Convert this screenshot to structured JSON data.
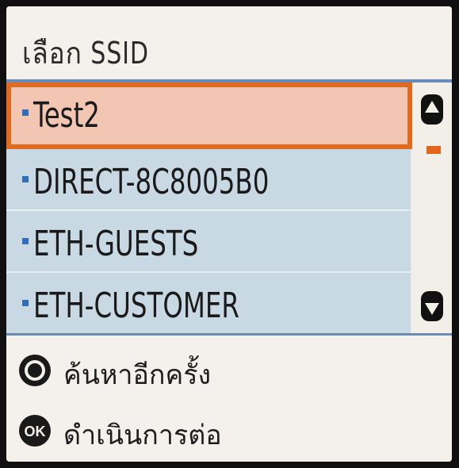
{
  "screen_title": "เลือก SSID",
  "networks": [
    {
      "label": "Test2",
      "selected": true
    },
    {
      "label": "DIRECT-8C8005B0",
      "selected": false
    },
    {
      "label": "ETH-GUESTS",
      "selected": false
    },
    {
      "label": "ETH-CUSTOMER",
      "selected": false
    }
  ],
  "footer": {
    "search_again_label": "ค้นหาอีกครั้ง",
    "continue_label": "ดำเนินการต่อ",
    "ok_icon_text": "OK"
  },
  "colors": {
    "selection_border": "#e06a1e",
    "selection_fill": "#f2c6b2",
    "list_background": "#c9d9e4",
    "bullet": "#2f6fb8",
    "scroll_thumb": "#e2651c"
  }
}
